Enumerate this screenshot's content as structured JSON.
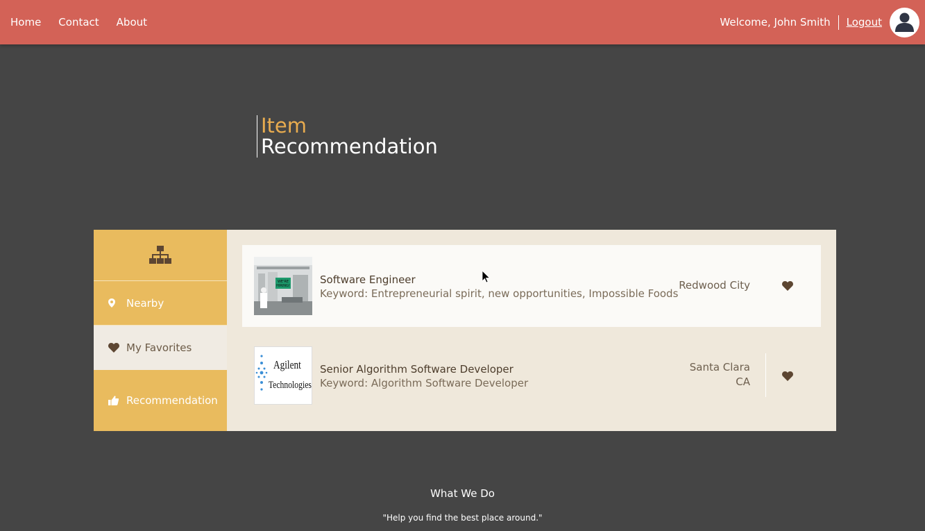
{
  "nav": {
    "links": [
      "Home",
      "Contact",
      "About"
    ],
    "welcome": "Welcome, John Smith",
    "logout": "Logout"
  },
  "header": {
    "line1": "Item",
    "line2": "Recommendation"
  },
  "sidebar": {
    "logo_icon": "sitemap-icon",
    "items": [
      {
        "label": "Nearby",
        "icon": "map-marker-icon"
      },
      {
        "label": "My Favorites",
        "icon": "heart-icon"
      },
      {
        "label": "Recommendation",
        "icon": "thumbs-up-icon"
      }
    ],
    "active_index": 1
  },
  "items": [
    {
      "name": "Software Engineer",
      "keyword": "Keyword: Entrepreneurial spirit, new opportunities, Impossible Foods",
      "location_line1": "Redwood City",
      "location_line2": "",
      "thumbnail": "we-are-hiring-photo",
      "favorite": true
    },
    {
      "name": "Senior Algorithm Software Developer",
      "keyword": "Keyword: Algorithm Software Developer",
      "location_line1": "Santa Clara",
      "location_line2": "CA",
      "thumbnail": "agilent-technologies-logo",
      "thumbnail_text": "Agilent Technologies",
      "favorite": true
    }
  ],
  "footer": {
    "title": "What We Do",
    "quote": "\"Help you find the best place around.\""
  },
  "colors": {
    "topbar": "#d36257",
    "page_bg": "#454545",
    "sidebar": "#e9bb5e",
    "accent_title": "#e9ac4f",
    "panel_bg": "#efe8db",
    "heart": "#5d4632"
  }
}
